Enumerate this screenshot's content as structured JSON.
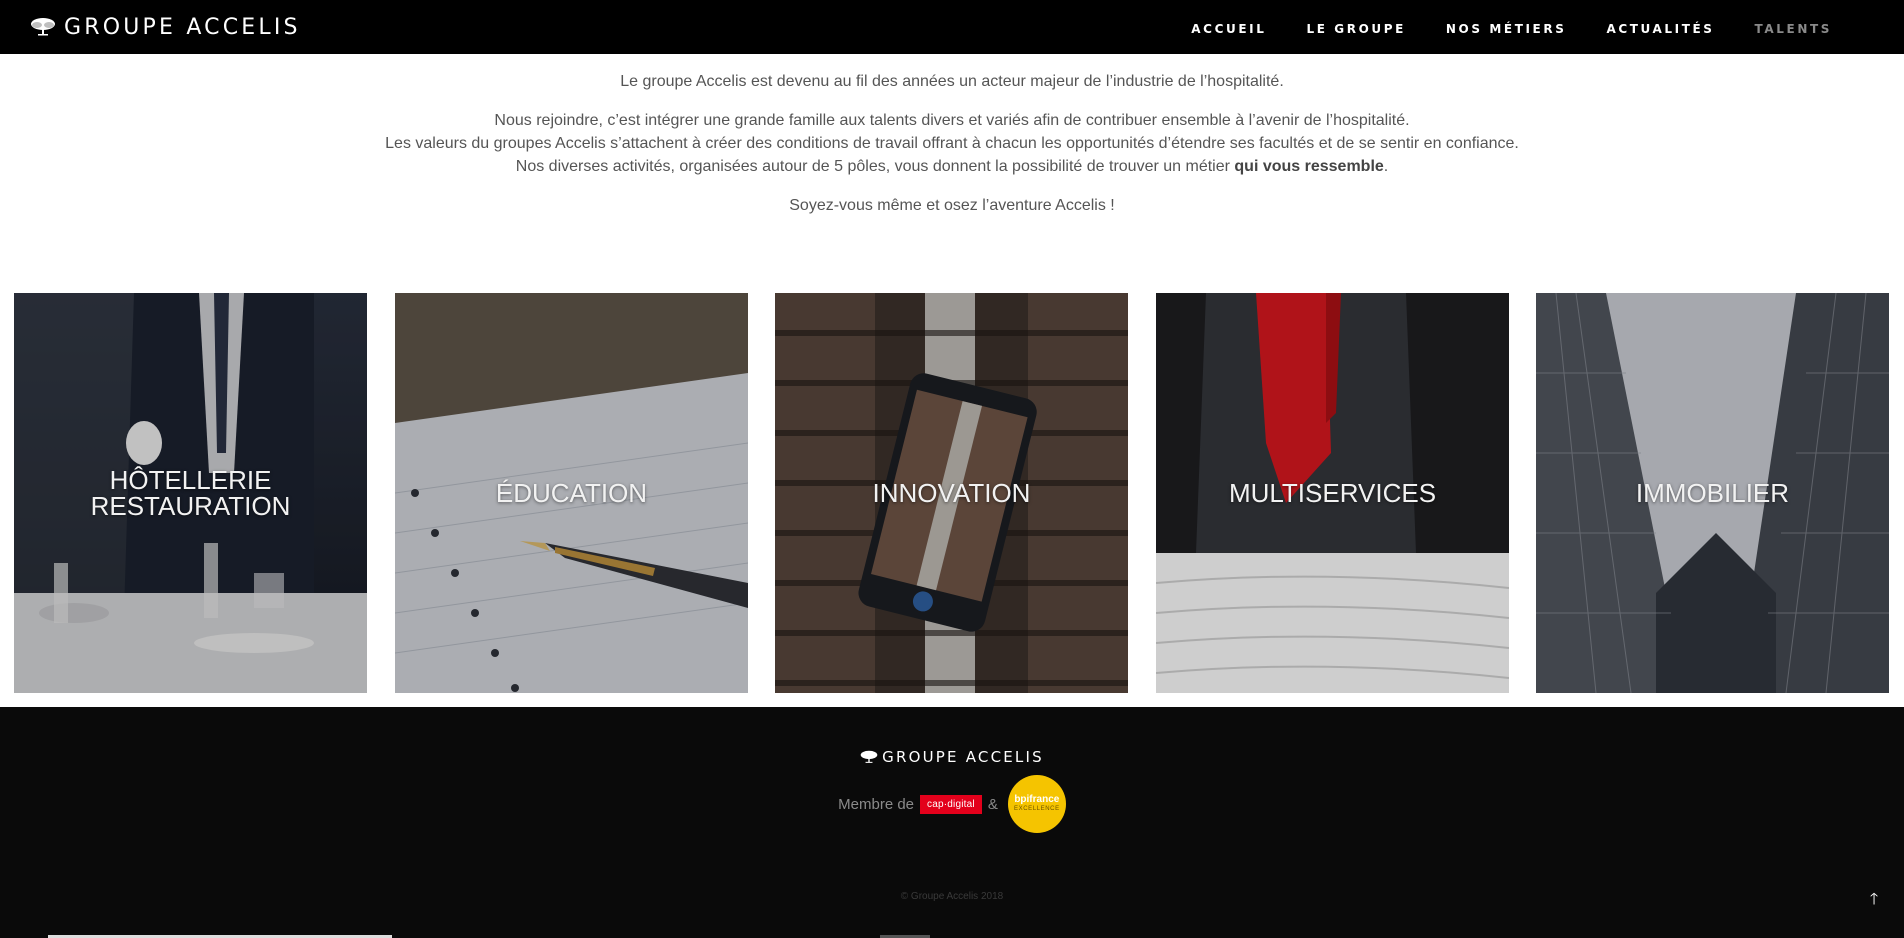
{
  "header": {
    "brand": "GROUPE ACCELIS",
    "brand_icon": "tree-logo-icon",
    "nav": [
      {
        "label": "ACCUEIL"
      },
      {
        "label": "LE GROUPE"
      },
      {
        "label": "NOS MÉTIERS"
      },
      {
        "label": "ACTUALITÉS"
      },
      {
        "label": "TALENTS",
        "active": true
      }
    ]
  },
  "intro": {
    "p1": "Le groupe Accelis est devenu au fil des années un acteur majeur de l’industrie de l’hospitalité.",
    "p2": "Nous rejoindre, c’est intégrer une grande famille aux talents divers et variés afin de contribuer ensemble à l’avenir de l’hospitalité.",
    "p3": "Les valeurs du groupes Accelis s’attachent à créer des conditions de travail offrant à chacun les opportunités d’étendre ses facultés et de se sentir en confiance.",
    "p4_pre": "Nos diverses activités, organisées autour de 5 pôles, vous donnent la possibilité de trouver un métier ",
    "p4_bold": "qui vous ressemble",
    "p4_post": ".",
    "p5": "Soyez-vous même et osez l’aventure Accelis !"
  },
  "tiles": [
    {
      "line1": "HÔTELLERIE",
      "line2": "RESTAURATION"
    },
    {
      "line1": "ÉDUCATION",
      "line2": ""
    },
    {
      "line1": "INNOVATION",
      "line2": ""
    },
    {
      "line1": "MULTISERVICES",
      "line2": ""
    },
    {
      "line1": "IMMOBILIER",
      "line2": ""
    }
  ],
  "footer": {
    "brand": "GROUPE ACCELIS",
    "member_label": "Membre de",
    "cap_digital": "cap·digital",
    "amp": "&",
    "bpi_top": "bpifrance",
    "bpi_bottom": "EXCELLENCE",
    "copyright": "© Groupe Accelis 2018",
    "back_to_top": "🡑"
  },
  "colors": {
    "header_bg": "#000000",
    "footer_bg": "#0a0a0a",
    "cap_red": "#e3001b",
    "bpi_yellow": "#f5c400"
  }
}
